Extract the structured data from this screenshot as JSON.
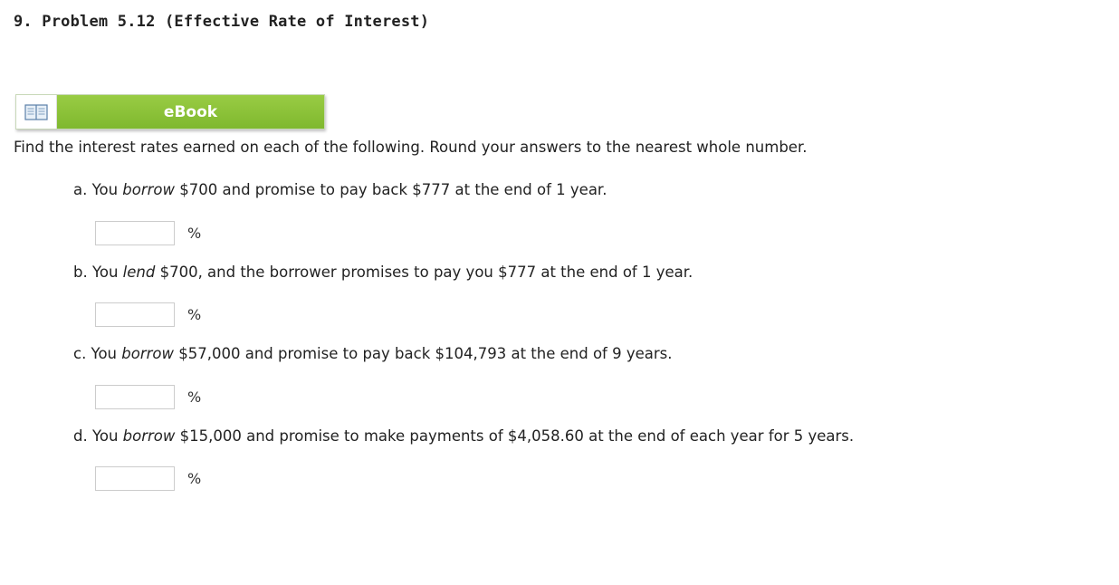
{
  "problem": {
    "title": "9. Problem 5.12 (Effective Rate of Interest)",
    "ebook_label": "eBook",
    "ebook_icon": "book-icon",
    "instructions": "Find the interest rates earned on each of the following. Round your answers to the nearest whole number."
  },
  "questions": [
    {
      "prefix": "a. You ",
      "keyword": "borrow",
      "text": " $700 and promise to pay back $777 at the end of 1 year.",
      "answer_value": "",
      "unit": "%"
    },
    {
      "prefix": "b. You ",
      "keyword": "lend",
      "text": " $700, and the borrower promises to pay you $777 at the end of 1 year.",
      "answer_value": "",
      "unit": "%"
    },
    {
      "prefix": "c. You ",
      "keyword": "borrow",
      "text": " $57,000 and promise to pay back $104,793 at the end of 9 years.",
      "answer_value": "",
      "unit": "%"
    },
    {
      "prefix": "d. You ",
      "keyword": "borrow",
      "text": " $15,000 and promise to make payments of $4,058.60 at the end of each year for 5 years.",
      "answer_value": "",
      "unit": "%"
    }
  ],
  "colors": {
    "ebook_green": "#8dc23a",
    "text": "#222222",
    "input_border": "#cccccc"
  }
}
